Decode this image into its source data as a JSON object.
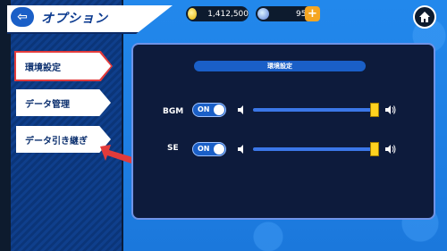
{
  "header": {
    "title": "オプション",
    "coins": "1,412,500",
    "gems": "95"
  },
  "sidebar": {
    "items": [
      {
        "label": "環境設定",
        "active": true
      },
      {
        "label": "データ管理",
        "active": false
      },
      {
        "label": "データ引き継ぎ",
        "active": false
      }
    ]
  },
  "panel": {
    "title": "環境設定",
    "rows": [
      {
        "label": "BGM",
        "toggle": "ON",
        "volume_fraction": 1.0
      },
      {
        "label": "SE",
        "toggle": "ON",
        "volume_fraction": 1.0
      }
    ]
  },
  "colors": {
    "background": "#1d7fe0",
    "panel": "#0d1b3c",
    "accent": "#1a5fc7",
    "thumb": "#ffd21f",
    "highlight": "#e33b3b"
  },
  "icons": {
    "back": "back-arrow-icon",
    "home": "home-icon",
    "coin": "coin-icon",
    "gem": "gem-icon",
    "plus": "plus-icon",
    "speaker_low": "speaker-mute-icon",
    "speaker_high": "speaker-loud-icon"
  }
}
